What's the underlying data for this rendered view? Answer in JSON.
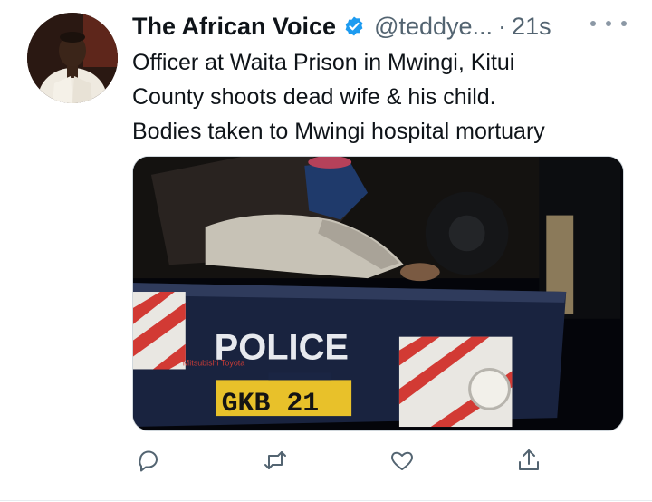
{
  "tweet": {
    "author_name": "The African Voice",
    "author_handle": "@teddye...",
    "separator": "·",
    "timestamp": "21s",
    "verified": true,
    "text": "Officer at Waita Prison in Mwingi, Kitui\nCounty shoots dead wife & his child.\nBodies taken to Mwingi hospital mortuary"
  },
  "media": {
    "police_text": "POLICE",
    "plate_text": "GKB 21",
    "door_text": "Mitsubishi Toyota"
  },
  "icons": {
    "verified": "verified-badge-icon",
    "more": "more-options-icon",
    "reply": "reply-icon",
    "retweet": "retweet-icon",
    "like": "like-icon",
    "share": "share-icon"
  },
  "colors": {
    "accent": "#1d9bf0",
    "secondary_text": "#536471",
    "action_icon": "#536471"
  }
}
